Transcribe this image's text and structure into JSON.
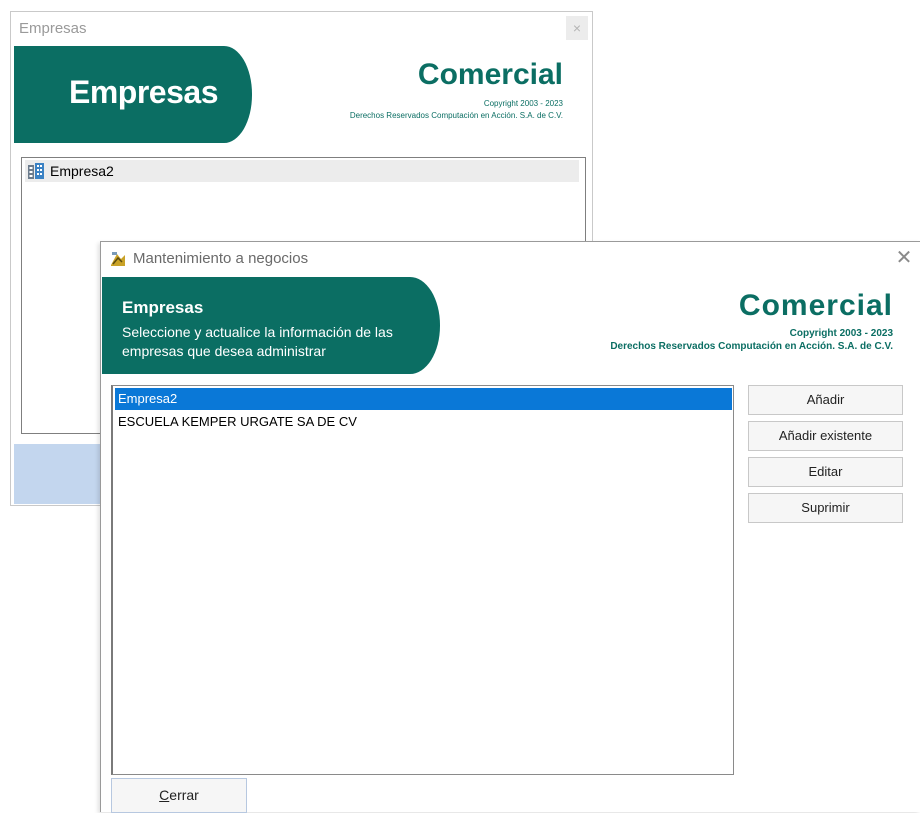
{
  "background_window": {
    "title": "Empresas",
    "close_label": "×",
    "banner_title": "Empresas",
    "brand": "Comercial",
    "copyright": "Copyright 2003 - 2023",
    "rights": "Derechos Reservados Computación en Acción. S.A. de C.V.",
    "tree_items": [
      {
        "label": "Empresa2",
        "icon": "building-icon"
      }
    ]
  },
  "dialog": {
    "title": "Mantenimiento a negocios",
    "close_label": "✕",
    "banner_title": "Empresas",
    "banner_text": "Seleccione y actualice la información de las empresas que desea administrar",
    "brand": "Comercial",
    "copyright": "Copyright 2003 - 2023",
    "rights": "Derechos Reservados Computación en Acción. S.A. de C.V.",
    "list_items": [
      {
        "label": "Empresa2",
        "selected": true
      },
      {
        "label": "ESCUELA KEMPER URGATE SA DE CV",
        "selected": false
      }
    ],
    "buttons": {
      "add": "Añadir",
      "add_existing": "Añadir existente",
      "edit": "Editar",
      "delete": "Suprimir"
    },
    "close_button": {
      "mnemonic": "C",
      "rest": "errar"
    }
  },
  "colors": {
    "brand_teal": "#0b6e63",
    "selection_blue": "#0a78d7"
  }
}
